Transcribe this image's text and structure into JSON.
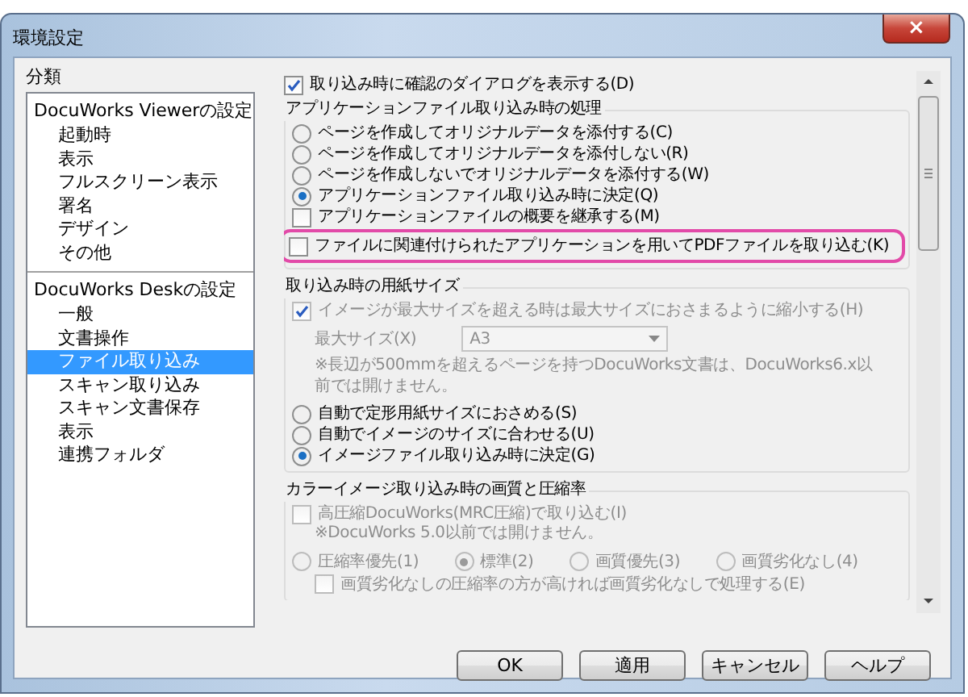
{
  "window": {
    "title": "環境設定",
    "close_label": "×"
  },
  "sidebar": {
    "label": "分類",
    "groups": [
      {
        "heading": "DocuWorks Viewerの設定",
        "items": [
          {
            "label": "起動時",
            "selected": false
          },
          {
            "label": "表示",
            "selected": false
          },
          {
            "label": "フルスクリーン表示",
            "selected": false
          },
          {
            "label": "署名",
            "selected": false
          },
          {
            "label": "デザイン",
            "selected": false
          },
          {
            "label": "その他",
            "selected": false
          }
        ]
      },
      {
        "heading": "DocuWorks Deskの設定",
        "items": [
          {
            "label": "一般",
            "selected": false
          },
          {
            "label": "文書操作",
            "selected": false
          },
          {
            "label": "ファイル取り込み",
            "selected": true
          },
          {
            "label": "スキャン取り込み",
            "selected": false
          },
          {
            "label": "スキャン文書保存",
            "selected": false
          },
          {
            "label": "表示",
            "selected": false
          },
          {
            "label": "連携フォルダ",
            "selected": false
          }
        ]
      }
    ]
  },
  "top_option": {
    "label": "取り込み時に確認のダイアログを表示する(D)",
    "checked": true
  },
  "sections": [
    {
      "title": "アプリケーションファイル取り込み時の処理",
      "items": [
        {
          "kind": "radio",
          "label": "ページを作成してオリジナルデータを添付する(C)",
          "selected": false,
          "disabled": false
        },
        {
          "kind": "radio",
          "label": "ページを作成してオリジナルデータを添付しない(R)",
          "selected": false,
          "disabled": false
        },
        {
          "kind": "radio",
          "label": "ページを作成しないでオリジナルデータを添付する(W)",
          "selected": false,
          "disabled": false
        },
        {
          "kind": "radio",
          "label": "アプリケーションファイル取り込み時に決定(Q)",
          "selected": true,
          "disabled": false
        },
        {
          "kind": "checkbox",
          "label": "アプリケーションファイルの概要を継承する(M)",
          "checked": false,
          "disabled": false,
          "highlighted": false
        },
        {
          "kind": "checkbox",
          "label": "ファイルに関連付けられたアプリケーションを用いてPDFファイルを取り込む(K)",
          "checked": false,
          "disabled": false,
          "highlighted": true
        }
      ]
    },
    {
      "title": "取り込み時の用紙サイズ",
      "items": [
        {
          "kind": "checkbox",
          "label": "イメージが最大サイズを超える時は最大サイズにおさまるように縮小する(H)",
          "checked": true,
          "disabled": true,
          "highlighted": false
        },
        {
          "kind": "dropdown",
          "label": "最大サイズ(X)",
          "value": "A3",
          "disabled": true
        },
        {
          "kind": "note",
          "label": "※長辺が500mmを超えるページを持つDocuWorks文書は、DocuWorks6.x以前では開けません。",
          "disabled": true
        },
        {
          "kind": "radio",
          "label": "自動で定形用紙サイズにおさめる(S)",
          "selected": false,
          "disabled": false
        },
        {
          "kind": "radio",
          "label": "自動でイメージのサイズに合わせる(U)",
          "selected": false,
          "disabled": false
        },
        {
          "kind": "radio",
          "label": "イメージファイル取り込み時に決定(G)",
          "selected": true,
          "disabled": false
        }
      ]
    },
    {
      "title": "カラーイメージ取り込み時の画質と圧縮率",
      "items": [
        {
          "kind": "checkbox",
          "label": "高圧縮DocuWorks(MRC圧縮)で取り込む(I)",
          "checked": false,
          "disabled": true,
          "highlighted": false
        },
        {
          "kind": "note",
          "label": "※DocuWorks 5.0以前では開けません。",
          "disabled": true
        },
        {
          "kind": "radio-row",
          "disabled": true,
          "options": [
            {
              "label": "圧縮率優先(1)",
              "selected": false
            },
            {
              "label": "標準(2)",
              "selected": true
            },
            {
              "label": "画質優先(3)",
              "selected": false
            },
            {
              "label": "画質劣化なし(4)",
              "selected": false
            }
          ]
        },
        {
          "kind": "checkbox",
          "label": "画質劣化なしの圧縮率の方が高ければ画質劣化なしで処理する(E)",
          "checked": false,
          "disabled": true,
          "highlighted": false
        }
      ]
    }
  ],
  "buttons": [
    {
      "label": "OK"
    },
    {
      "label": "適用"
    },
    {
      "label": "キャンセル"
    },
    {
      "label": "ヘルプ"
    }
  ]
}
